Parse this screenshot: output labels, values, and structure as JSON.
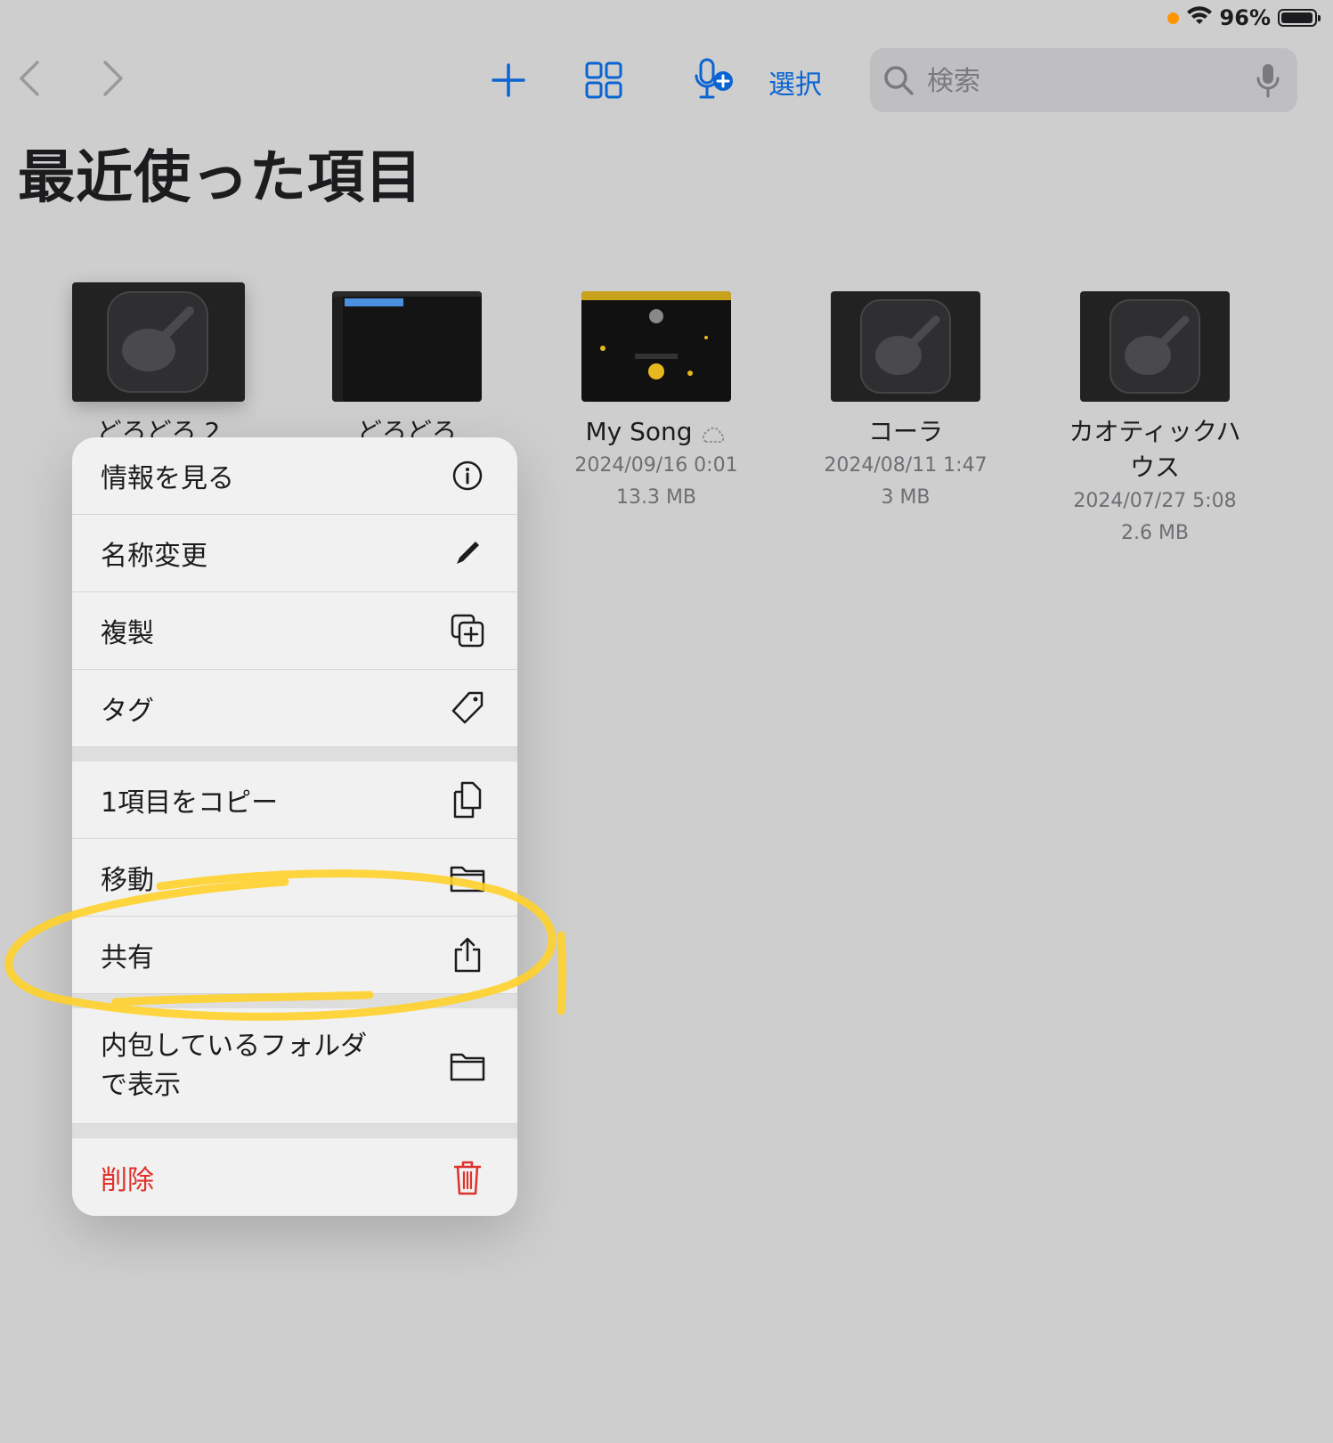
{
  "status": {
    "battery_text": "96%",
    "battery_level": 0.96
  },
  "toolbar": {
    "select_label": "選択"
  },
  "search": {
    "placeholder": "検索"
  },
  "page": {
    "title": "最近使った項目"
  },
  "files": [
    {
      "name": "どろどろ 2",
      "thumb": "garageband-icon"
    },
    {
      "name": "どろどろ",
      "thumb": "screenshot-blue"
    },
    {
      "name": "My Song",
      "date": "2024/09/16 0:01",
      "size": "13.3 MB",
      "thumb": "screenshot-yellow",
      "cloud": "cloud-icon"
    },
    {
      "name": "コーラ",
      "date": "2024/08/11 1:47",
      "size": "3 MB",
      "thumb": "garageband-icon"
    },
    {
      "name_line1": "カオティックハ",
      "name_line2": "ウス",
      "date": "2024/07/27 5:08",
      "size": "2.6 MB",
      "thumb": "garageband-icon"
    }
  ],
  "menu": {
    "group1": [
      {
        "label": "情報を見る",
        "icon": "info-icon"
      },
      {
        "label": "名称変更",
        "icon": "pencil-icon"
      },
      {
        "label": "複製",
        "icon": "duplicate-icon"
      },
      {
        "label": "タグ",
        "icon": "tag-icon"
      }
    ],
    "group2": [
      {
        "label": "1項目をコピー",
        "icon": "copy-icon"
      },
      {
        "label": "移動",
        "icon": "folder-move-icon"
      },
      {
        "label": "共有",
        "icon": "share-icon"
      }
    ],
    "group3": [
      {
        "label_line1": "内包しているフォルダ",
        "label_line2": "で表示",
        "icon": "folder-icon"
      }
    ],
    "group4": [
      {
        "label": "削除",
        "icon": "trash-icon"
      }
    ]
  },
  "colors": {
    "accent": "#0a64d2",
    "danger": "#e0312a",
    "highlight": "#ffd12a",
    "background": "#cecece"
  }
}
